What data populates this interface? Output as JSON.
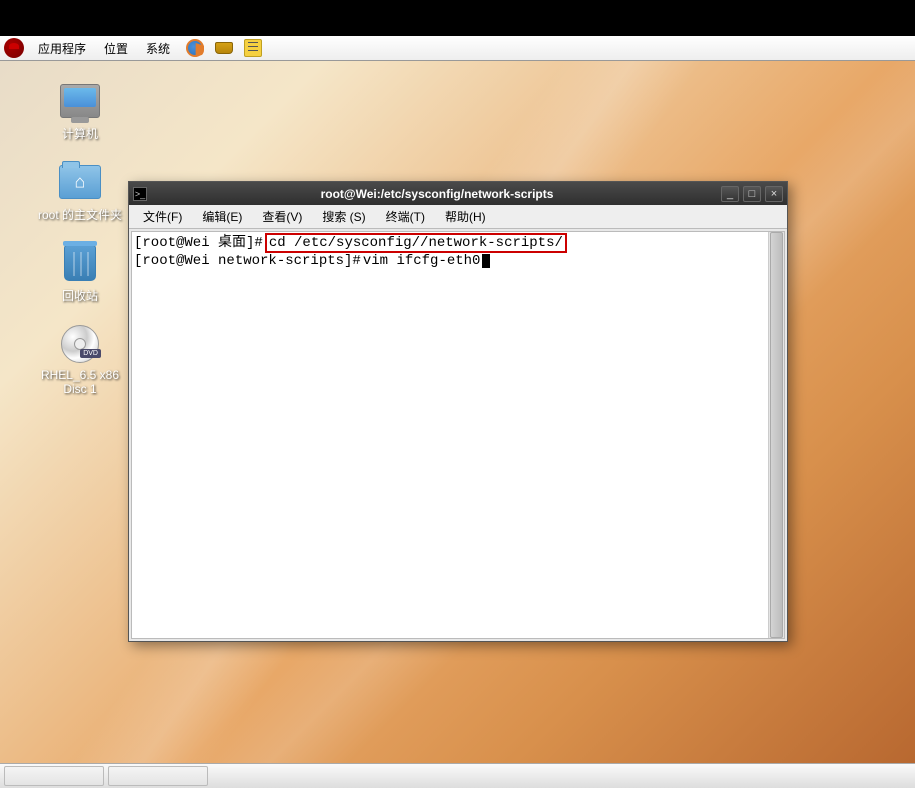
{
  "menubar": {
    "items": [
      "应用程序",
      "位置",
      "系统"
    ]
  },
  "desktop_icons": [
    {
      "label": "计算机"
    },
    {
      "label": "root 的主文件夹"
    },
    {
      "label": "回收站"
    },
    {
      "label": "RHEL_6.5 x86\nDisc 1"
    }
  ],
  "terminal": {
    "title": "root@Wei:/etc/sysconfig/network-scripts",
    "menu": [
      "文件(F)",
      "编辑(E)",
      "查看(V)",
      "搜索 (S)",
      "终端(T)",
      "帮助(H)"
    ],
    "line1_prompt": "[root@Wei 桌面]#",
    "line1_cmd": "cd /etc/sysconfig//network-scripts/",
    "line2_prompt": "[root@Wei network-scripts]#",
    "line2_cmd": "vim ifcfg-eth0"
  }
}
